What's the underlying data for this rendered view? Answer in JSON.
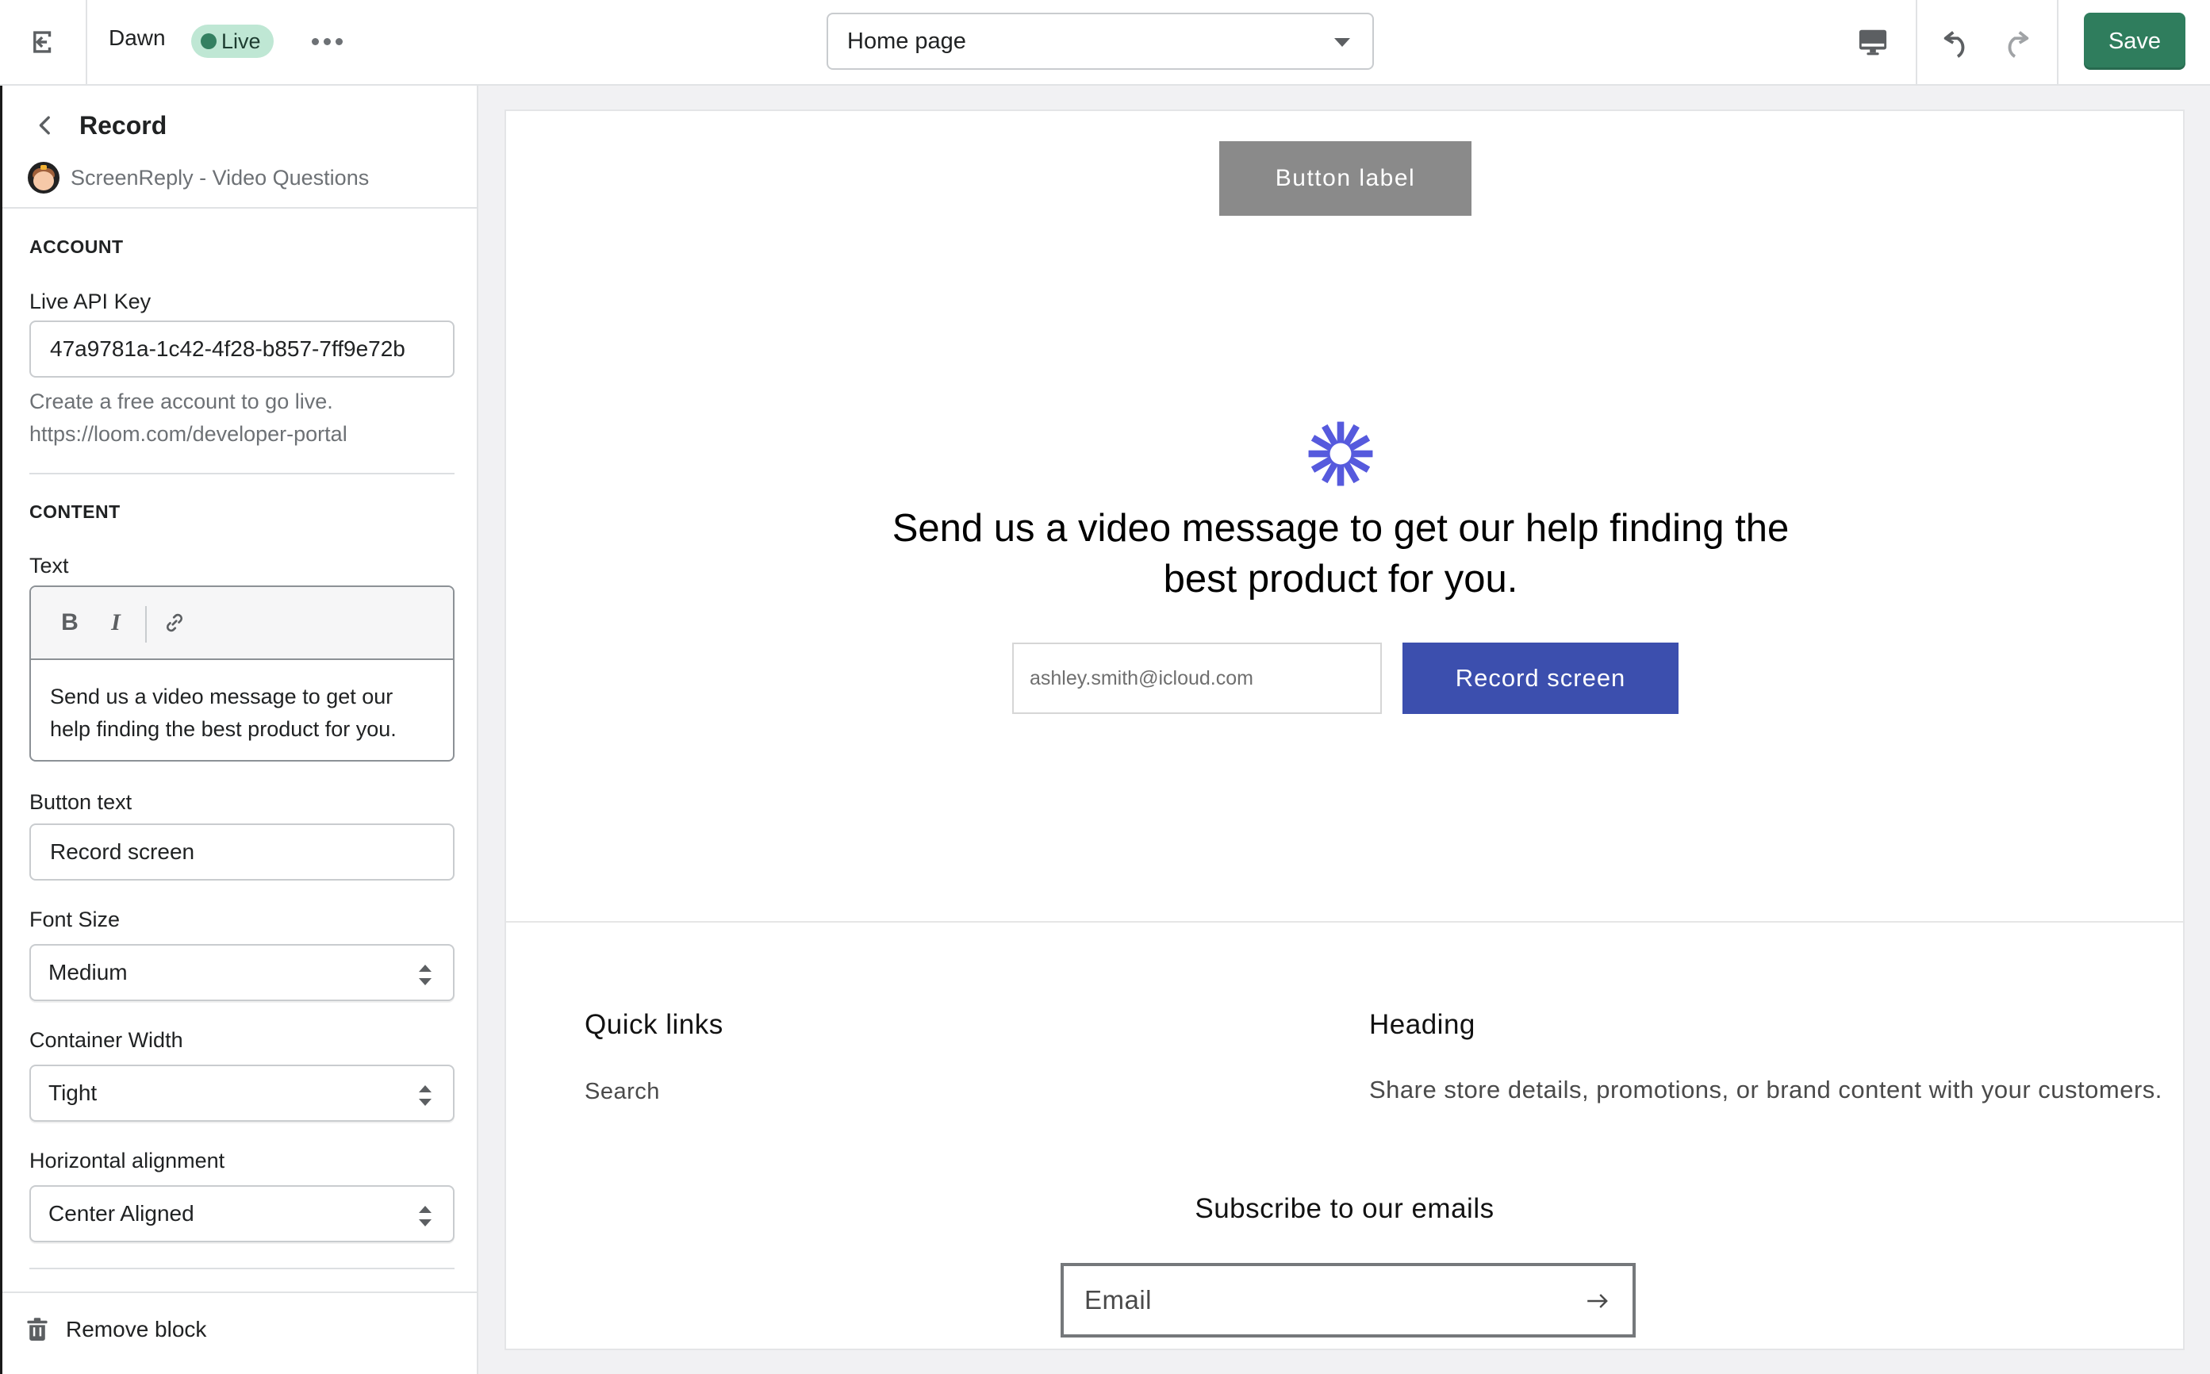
{
  "topbar": {
    "exit_icon": "exit-icon",
    "theme_name": "Dawn",
    "status_badge": "Live",
    "more_icon": "more-horizontal-icon",
    "page_selector": {
      "selected": "Home page",
      "icon": "caret-down-icon"
    },
    "device_icon": "desktop-icon",
    "undo_icon": "undo-icon",
    "redo_icon": "redo-icon",
    "save_label": "Save",
    "colors": {
      "save_bg": "#2f7d5d",
      "live_badge_bg": "#bfe7d4",
      "live_dot": "#348061"
    }
  },
  "sidebar": {
    "back_icon": "chevron-left-icon",
    "title": "Record",
    "app_name": "ScreenReply - Video Questions",
    "account": {
      "section_label": "ACCOUNT",
      "api_key_label": "Live API Key",
      "api_key_value": "47a9781a-1c42-4f28-b857-7ff9e72b",
      "help_line1": "Create a free account to go live.",
      "help_line2": "https://loom.com/developer-portal"
    },
    "content": {
      "section_label": "CONTENT",
      "text_label": "Text",
      "toolbar": {
        "bold": "B",
        "italic": "I",
        "link_icon": "link-icon"
      },
      "text_value": "Send us a video message to get our help finding the best product for you.",
      "button_text_label": "Button text",
      "button_text_value": "Record screen",
      "font_size_label": "Font Size",
      "font_size_value": "Medium",
      "container_width_label": "Container Width",
      "container_width_value": "Tight",
      "alignment_label": "Horizontal alignment",
      "alignment_value": "Center Aligned"
    },
    "footer": {
      "remove_icon": "trash-icon",
      "remove_label": "Remove block"
    }
  },
  "preview": {
    "placeholder_button": "Button label",
    "logo_icon": "loom-logo-icon",
    "heading": "Send us a video message to get our help finding the best product for you.",
    "email_value": "ashley.smith@icloud.com",
    "record_button": "Record screen",
    "colors": {
      "record_button_bg": "#3c4fae",
      "logo": "#565add",
      "placeholder_button_bg": "#8a8a8a"
    },
    "footer": {
      "quick_links_heading": "Quick links",
      "links": [
        "Search"
      ],
      "heading": "Heading",
      "text": "Share store details, promotions, or brand content with your customers.",
      "subscribe_title": "Subscribe to our emails",
      "email_placeholder": "Email",
      "submit_icon": "arrow-right-icon"
    }
  }
}
